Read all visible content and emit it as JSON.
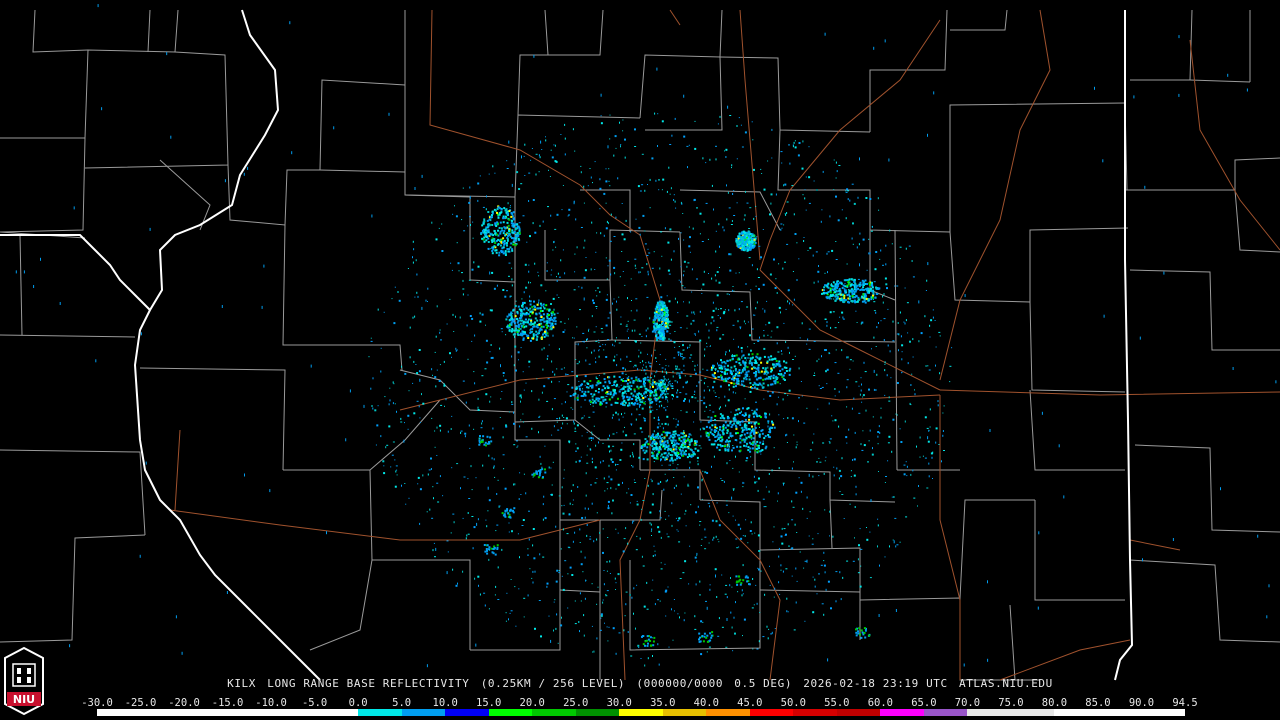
{
  "caption": {
    "station": "KILX",
    "product": "LONG RANGE BASE REFLECTIVITY",
    "resolution": "(0.25KM / 256 LEVEL)",
    "code": "(000000/0000",
    "elevation": "0.5 DEG)",
    "datetime": "2026-02-18 23:19 UTC",
    "site": "ATLAS.NIU.EDU"
  },
  "logo_text": "NIU",
  "colors": {
    "background": "#000000",
    "county_lines": "#9a9a9a",
    "state_lines": "#ffffff",
    "highways": "#a0522d"
  },
  "scale": {
    "labels": [
      "-30.0",
      "-25.0",
      "-20.0",
      "-15.0",
      "-10.0",
      "-5.0",
      "0.0",
      "5.0",
      "10.0",
      "15.0",
      "20.0",
      "25.0",
      "30.0",
      "35.0",
      "40.0",
      "45.0",
      "50.0",
      "55.0",
      "60.0",
      "65.0",
      "70.0",
      "75.0",
      "80.0",
      "85.0",
      "90.0",
      "94.5"
    ],
    "colors": [
      "#ffffff",
      "#ffffff",
      "#ffffff",
      "#ffffff",
      "#ffffff",
      "#ffffff",
      "#00e8e8",
      "#009ef0",
      "#0000f6",
      "#00ff00",
      "#00c800",
      "#009000",
      "#ffff00",
      "#e7c000",
      "#ff9000",
      "#ff0000",
      "#d60000",
      "#c00000",
      "#ff00ff",
      "#9955c9",
      "#e8e8e8",
      "#e8e8e8",
      "#ffffff",
      "#ffffff",
      "#ffffff"
    ]
  }
}
